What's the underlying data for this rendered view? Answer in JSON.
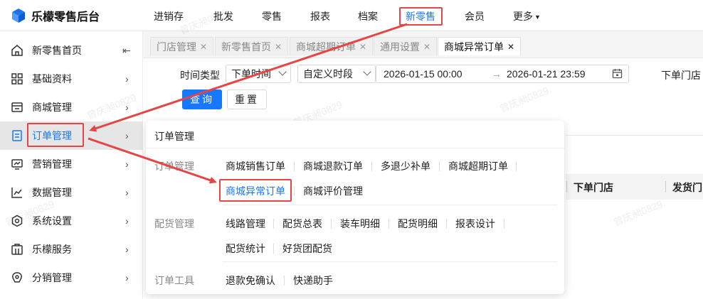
{
  "brand": {
    "title": "乐檬零售后台"
  },
  "topnav": {
    "items": [
      {
        "label": "进销存"
      },
      {
        "label": "批发"
      },
      {
        "label": "零售"
      },
      {
        "label": "报表"
      },
      {
        "label": "档案"
      },
      {
        "label": "新零售",
        "active": true
      },
      {
        "label": "会员"
      },
      {
        "label": "更多"
      }
    ]
  },
  "sidebar": {
    "items": [
      {
        "label": "新零售首页",
        "icon": "home-icon"
      },
      {
        "label": "基础资料",
        "icon": "grid-icon"
      },
      {
        "label": "商城管理",
        "icon": "store-icon"
      },
      {
        "label": "订单管理",
        "icon": "order-icon",
        "active": true
      },
      {
        "label": "营销管理",
        "icon": "marketing-icon"
      },
      {
        "label": "数据管理",
        "icon": "chart-icon"
      },
      {
        "label": "系统设置",
        "icon": "settings-icon"
      },
      {
        "label": "乐檬服务",
        "icon": "service-icon"
      },
      {
        "label": "分销管理",
        "icon": "distribution-icon"
      }
    ]
  },
  "tabs": [
    {
      "label": "门店管理"
    },
    {
      "label": "新零售首页"
    },
    {
      "label": "商城超期订单"
    },
    {
      "label": "通用设置"
    },
    {
      "label": "商城异常订单",
      "active": true
    }
  ],
  "filter": {
    "time_type_label": "时间类型",
    "time_type_value": "下单时间",
    "period_value": "自定义时段",
    "date_start": "2026-01-15 00:00",
    "date_end": "2026-01-21 23:59",
    "date_arrow": "→",
    "store_label": "下单门店",
    "query_button": "查询",
    "reset_button": "重置"
  },
  "table": {
    "headers": [
      "下单门店",
      "发货门"
    ]
  },
  "mega_menu": {
    "title": "订单管理",
    "groups": [
      {
        "name": "订单管理",
        "rows": [
          [
            "商城销售订单",
            "商城退款订单",
            "多退少补单",
            "商城超期订单"
          ],
          [
            "商城异常订单",
            "商城评价管理"
          ]
        ]
      },
      {
        "name": "配货管理",
        "rows": [
          [
            "线路管理",
            "配货总表",
            "装车明细",
            "配货明细",
            "报表设计"
          ],
          [
            "配货统计",
            "好货团配货"
          ]
        ]
      },
      {
        "name": "订单工具",
        "rows": [
          [
            "退款免确认",
            "快递助手"
          ]
        ]
      }
    ],
    "current": "商城异常订单"
  },
  "watermark": "曾庆昶0829",
  "colors": {
    "accent": "#1677ff",
    "highlight": "#e64545"
  }
}
